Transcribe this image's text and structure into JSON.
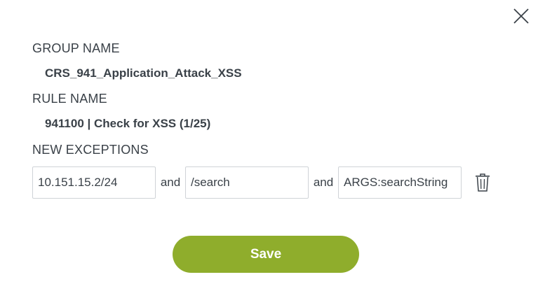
{
  "dialog": {
    "close_icon": "close-icon",
    "group": {
      "label": "GROUP NAME",
      "value": "CRS_941_Application_Attack_XSS"
    },
    "rule": {
      "label": "RULE NAME",
      "value": "941100 | Check for XSS (1/25)"
    },
    "exceptions": {
      "label": "NEW EXCEPTIONS",
      "fields": [
        {
          "value": "10.151.15.2/24"
        },
        {
          "value": "/search"
        },
        {
          "value": "ARGS:searchString"
        }
      ],
      "connector": "and",
      "delete_icon": "trash-icon"
    },
    "save_label": "Save",
    "colors": {
      "accent": "#8fad2c",
      "text": "#3a4148",
      "border": "#cfd3d7"
    }
  }
}
